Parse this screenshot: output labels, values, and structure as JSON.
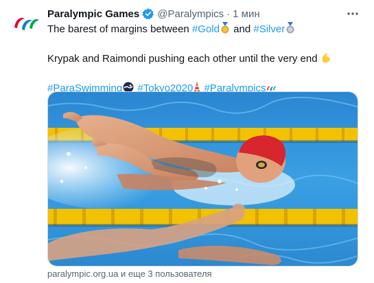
{
  "tweet": {
    "author_name": "Paralympic Games",
    "handle": "@Paralympics",
    "separator": "·",
    "time": "1 мин",
    "line1_text": "The barest of margins between ",
    "line1_tag1": "#Gold",
    "line1_and": " and ",
    "line1_tag2": "#Silver",
    "line2_text": "Krypak and Raimondi pushing each other until the very end",
    "hashtags": [
      "#ParaSwimming",
      "#Tokyo2020",
      "#Paralympics"
    ]
  },
  "footer": {
    "text": "paralympic.org.ua и еще 3 пользователя"
  },
  "colors": {
    "link": "#1d9bf0",
    "verified": "#1d9bf0",
    "secondary_text": "#536471",
    "pool_water": "#2f8fd6",
    "lane_rope_yellow": "#f2c200",
    "cap_red": "#d7262e"
  },
  "icons": {
    "verified": "verified-badge-icon",
    "more": "more-horizontal-icon",
    "gold_medal": "gold-medal-emoji",
    "silver_medal": "silver-medal-emoji",
    "flexed_biceps": "flexed-biceps-emoji",
    "swimmer": "swimmer-emoji",
    "tokyo_tower": "tokyo-tower-emoji",
    "agitos": "paralympic-agitos-emoji"
  }
}
